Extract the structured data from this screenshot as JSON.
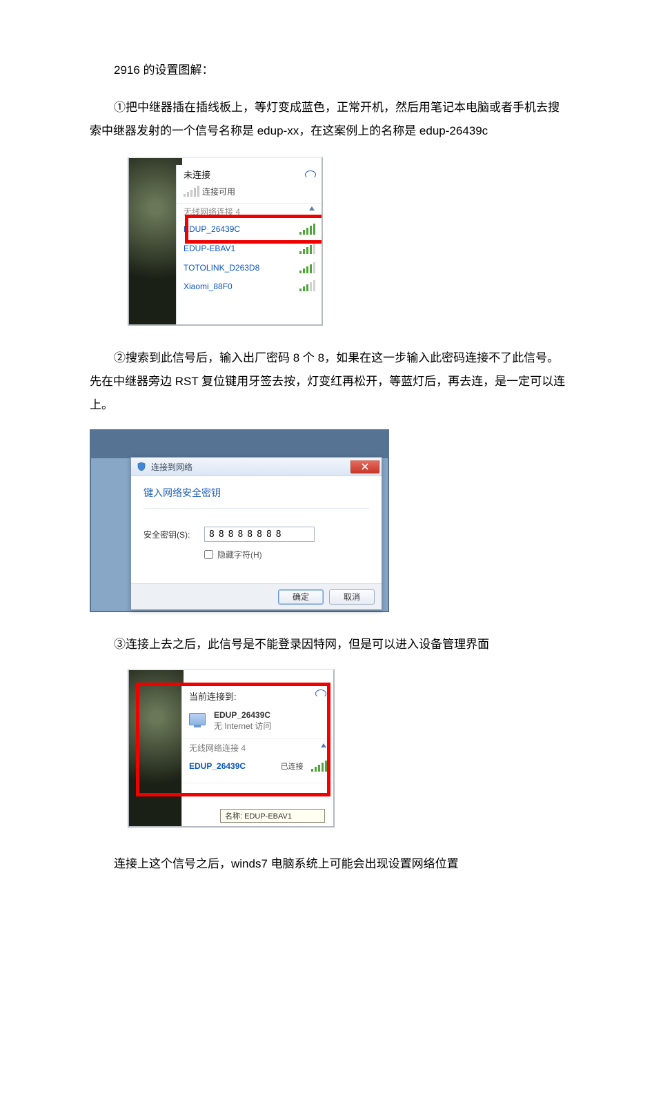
{
  "doc": {
    "title": "2916 的设置图解：",
    "p1": "①把中继器插在插线板上，等灯变成蓝色，正常开机，然后用笔记本电脑或者手机去搜索中继器发射的一个信号名称是 edup-xx，在这案例上的名称是 edup-26439c",
    "p2": "②搜索到此信号后，输入出厂密码 8 个 8，如果在这一步输入此密码连接不了此信号。先在中继器旁边 RST  复位键用牙签去按，灯变红再松开，等蓝灯后，再去连，是一定可以连上。",
    "p3": "③连接上去之后，此信号是不能登录因特网，但是可以进入设备管理界面",
    "p4": "连接上这个信号之后，winds7 电脑系统上可能会出现设置网络位置"
  },
  "wifi1": {
    "header": "未连接",
    "available": "连接可用",
    "section": "无线网络连接 4",
    "networks": [
      {
        "ssid": "EDUP_26439C",
        "strength": 5
      },
      {
        "ssid": "EDUP-EBAV1",
        "strength": 4
      },
      {
        "ssid": "TOTOLINK_D263D8",
        "strength": 4
      },
      {
        "ssid": "Xiaomi_88F0",
        "strength": 3
      }
    ]
  },
  "dialog": {
    "title": "连接到网络",
    "section": "键入网络安全密钥",
    "field_label": "安全密钥(S):",
    "field_value": "88888888",
    "hide_chars": "隐藏字符(H)",
    "ok": "确定",
    "cancel": "取消"
  },
  "wifi3": {
    "header": "当前连接到:",
    "name_bold": "EDUP_26439C",
    "no_internet": "无 Internet 访问",
    "section": "无线网络连接 4",
    "connected_ssid": "EDUP_26439C",
    "status_connected": "已连接",
    "tip_fragment": "名称: EDUP-EBAV1"
  }
}
